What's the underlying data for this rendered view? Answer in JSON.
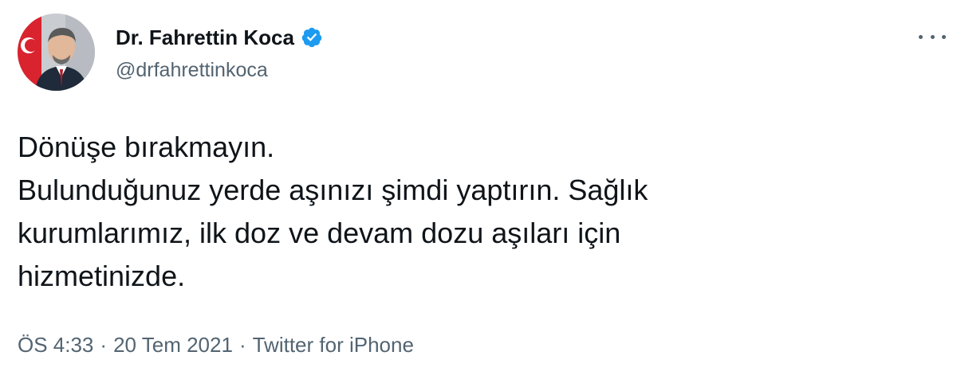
{
  "author": {
    "display_name": "Dr. Fahrettin Koca",
    "handle": "@drfahrettinkoca",
    "verified": true,
    "avatar_icon": "profile-photo",
    "verified_color": "#1d9bf0"
  },
  "tweet": {
    "lines": [
      "Dönüşe bırakmayın.",
      "Bulunduğunuz yerde aşınızı şimdi yaptırın. Sağlık",
      "kurumlarımız, ilk doz ve devam dozu aşıları için",
      "hizmetinizde."
    ]
  },
  "meta": {
    "time": "ÖS 4:33",
    "separator": "·",
    "date": "20 Tem 2021",
    "source": "Twitter for iPhone"
  },
  "menu": {
    "icon": "more-icon"
  }
}
